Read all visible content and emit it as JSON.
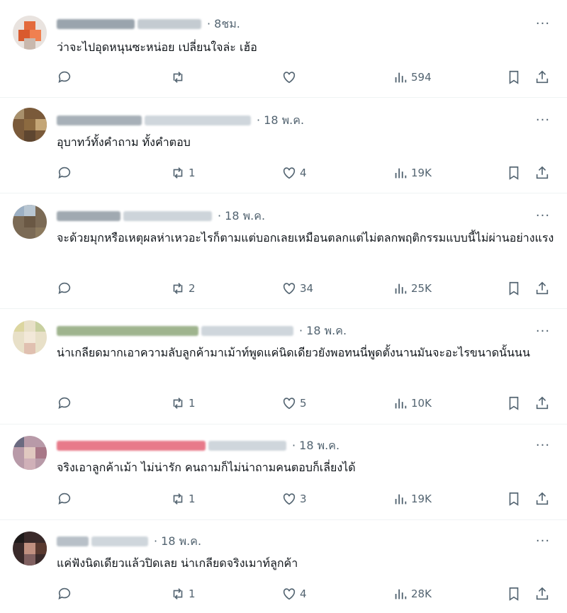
{
  "posts": [
    {
      "time": "8ชม.",
      "text": "ว่าจะไปอุดหนุนซะหน่อย เปลี่ยนใจล่ะ เฮ้อ",
      "replies": "",
      "reposts": "",
      "likes": "",
      "views": "594"
    },
    {
      "time": "18 พ.ค.",
      "text": "อุบาทว์ทั้งคำถาม ทั้งคำตอบ",
      "replies": "",
      "reposts": "1",
      "likes": "4",
      "views": "19K"
    },
    {
      "time": "18 พ.ค.",
      "text": "จะด้วยมุกหรือเหตุผลห่าเหวอะไรก็ตามแต่บอกเลยเหมือนตลกแต่ไม่ตลกพฤติกรรมแบบนี้ไม่ผ่านอย่างแรง",
      "replies": "",
      "reposts": "2",
      "likes": "34",
      "views": "25K"
    },
    {
      "time": "18 พ.ค.",
      "text": "น่าเกลียดมากเอาความลับลูกค้ามาเม้าท์พูดแค่นิดเดียวยังพอทนนี่พูดตั้งนานมันจะอะไรขนาดนั้นนน",
      "replies": "",
      "reposts": "1",
      "likes": "5",
      "views": "10K"
    },
    {
      "time": "18 พ.ค.",
      "text": "จริงเอาลูกค้าเม้า ไม่น่ารัก คนถามก็ไม่น่าถามคนตอบก็เลี่ยงได้",
      "replies": "",
      "reposts": "1",
      "likes": "3",
      "views": "19K"
    },
    {
      "time": "18 พ.ค.",
      "text": "แค่ฟังนิดเดียวแล้วปิดเลย น่าเกลียดจริงเมาท์ลูกค้า",
      "replies": "",
      "reposts": "1",
      "likes": "4",
      "views": "28K"
    }
  ],
  "icons": {
    "reply": "reply-icon",
    "repost": "repost-icon",
    "like": "like-icon",
    "views": "views-icon",
    "bookmark": "bookmark-icon",
    "share": "share-icon",
    "more": "more-icon"
  },
  "colors": {
    "text": "#0f1419",
    "muted": "#536471",
    "divider": "#eff3f4"
  }
}
